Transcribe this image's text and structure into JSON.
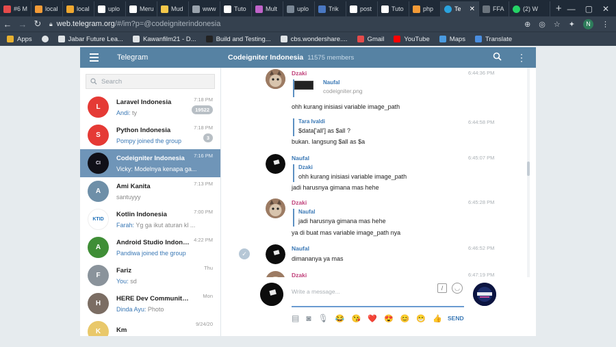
{
  "browser": {
    "tabs": [
      {
        "label": "#6 M",
        "color": "#e54b4b"
      },
      {
        "label": "local",
        "color": "#f49b37"
      },
      {
        "label": "local",
        "color": "#f0a830"
      },
      {
        "label": "uplo",
        "color": "#ffffff"
      },
      {
        "label": "Meru",
        "color": "#ffffff"
      },
      {
        "label": "Mud",
        "color": "#f5c84a"
      },
      {
        "label": "www",
        "color": "#9aa3ad"
      },
      {
        "label": "Tuto",
        "color": "#ffffff"
      },
      {
        "label": "Mult",
        "color": "#c063c9"
      },
      {
        "label": "uplo",
        "color": "#7a8795"
      },
      {
        "label": "Trik",
        "color": "#4a78c2"
      },
      {
        "label": "post",
        "color": "#ffffff"
      },
      {
        "label": "Tuto",
        "color": "#ffffff"
      },
      {
        "label": "php",
        "color": "#f49b37"
      }
    ],
    "active_tab": {
      "label": "Te",
      "color": "#2aa3df"
    },
    "tab_ffa": {
      "label": "FFA",
      "color": "#6b747d"
    },
    "tab_whatsapp": {
      "label": "(2) W",
      "color": "#25d366"
    },
    "new_tab": "+",
    "url_host": "web.telegram.org",
    "url_path": "/#/im?p=@codeigniterindonesia",
    "profile_initial": "N",
    "bookmarks": [
      {
        "label": "Apps",
        "color": "#e8b130"
      },
      {
        "label": "",
        "color": "#dfe3e6"
      },
      {
        "label": "Jabar Future Lea...",
        "color": "#dfe3e6"
      },
      {
        "label": "Kawanfilm21 - D...",
        "color": "#dfe3e6"
      },
      {
        "label": "Build and Testing...",
        "color": "#222222"
      },
      {
        "label": "cbs.wondershare....",
        "color": "#dfe3e6"
      },
      {
        "label": "Gmail",
        "color": "#e54b4b"
      },
      {
        "label": "YouTube",
        "color": "#ff0000"
      },
      {
        "label": "Maps",
        "color": "#4a9be0"
      },
      {
        "label": "Translate",
        "color": "#4a8ee0"
      }
    ]
  },
  "telegram": {
    "brand": "Telegram",
    "chat_title": "Codeigniter Indonesia",
    "chat_members": "11575 members",
    "search_placeholder": "Search",
    "dialogs": [
      {
        "name": "Laravel Indonesia",
        "time": "7:18 PM",
        "sender": "Andi:",
        "msg": " ty",
        "badge": "19522",
        "avatar": "#e53a35",
        "initial": "L"
      },
      {
        "name": "Python Indonesia",
        "time": "7:18 PM",
        "sender": "",
        "msg": "Pompy joined the group",
        "badge": "3",
        "avatar": "#e53a35",
        "initial": "S"
      },
      {
        "name": "Codeigniter Indonesia",
        "time": "7:16 PM",
        "sender": "Vicky:",
        "msg": " Modelnya kenapa ga...",
        "badge": "",
        "avatar": "#101018",
        "initial": "CI"
      },
      {
        "name": "Ami Kanita",
        "time": "7:13 PM",
        "sender": "",
        "msg": "santuyyy",
        "badge": "",
        "avatar": "#6e8fa8",
        "initial": "A"
      },
      {
        "name": "Kotlin Indonesia",
        "time": "7:00 PM",
        "sender": "Farah:",
        "msg": " Yg ga ikut aturan kl ...",
        "badge": "",
        "avatar": "#ffffff",
        "initial": "KTID"
      },
      {
        "name": "Android Studio Indonesia",
        "time": "4:22 PM",
        "sender": "",
        "msg": "Pandiwa joined the group",
        "badge": "",
        "avatar": "#3f8e36",
        "initial": "A"
      },
      {
        "name": "Fariz",
        "time": "Thu",
        "sender": "You:",
        "msg": " sd",
        "badge": "",
        "avatar": "#8a939b",
        "initial": "F"
      },
      {
        "name": "HERE Dev Community ID",
        "time": "Mon",
        "sender": "Dinda Ayu:",
        "msg": " Photo",
        "badge": "",
        "avatar": "#7b6d63",
        "initial": "H"
      },
      {
        "name": "Km",
        "time": "9/24/20",
        "sender": "",
        "msg": "",
        "badge": "",
        "avatar": "#e9c86a",
        "initial": "K"
      }
    ],
    "messages": {
      "m1": {
        "author": "Dzaki",
        "time": "6:44:36 PM",
        "reply_author": "Naufal",
        "reply_file": "codeigniter.png",
        "text": "ohh kurang inisiasi variable image_path"
      },
      "m2": {
        "reply_author": "Tara Ivaldi",
        "time": "6:44:58 PM",
        "reply_text": "$data['all'] as $all ?",
        "text": "bukan. langsung $all as $a"
      },
      "m3": {
        "author": "Naufal",
        "time": "6:45:07 PM",
        "reply_author": "Dzaki",
        "reply_text": "ohh kurang inisiasi variable image_path",
        "text": "jadi harusnya gimana mas hehe"
      },
      "m4": {
        "author": "Dzaki",
        "time": "6:45:28 PM",
        "reply_author": "Naufal",
        "reply_text": "jadi harusnya gimana mas hehe",
        "text": "ya di buat mas variable image_path nya"
      },
      "m5": {
        "author": "Naufal",
        "time": "6:46:52 PM",
        "text": "dimananya ya mas"
      },
      "m6": {
        "author": "Dzaki",
        "time": "6:47:19 PM"
      }
    },
    "composer": {
      "placeholder": "Write a message...",
      "send_label": "SEND",
      "emojis": [
        "😂",
        "😘",
        "❤️",
        "😍",
        "😊",
        "😁",
        "👍"
      ]
    },
    "colors": {
      "header": "#5682a3",
      "author_dzaki": "#c0407a",
      "author_naufal": "#3a78b5",
      "selected_dialog": "#6f95b8"
    }
  }
}
